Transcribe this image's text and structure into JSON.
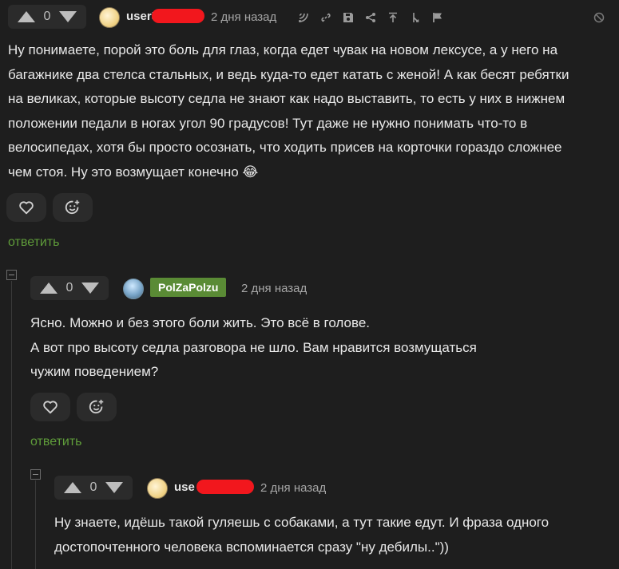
{
  "comments": [
    {
      "rating": "0",
      "username": "user5",
      "time": "2 дня назад",
      "body_lines": [
        "Ну понимаете, порой это боль для глаз, когда едет чувак на новом лексусе, а у него на",
        "багажнике два стелса стальных, и ведь куда-то едет катать с женой! А как бесят ребятки",
        "на великах, которые высоту седла не знают как надо выставить, то есть у них в нижнем",
        "положении педали в ногах угол 90 градусов! Тут даже не нужно понимать что-то в",
        "велосипедах, хотя бы просто осознать, что ходить присев на корточки гораздо сложнее",
        "чем стоя. Ну это возмущает конечно 😂"
      ],
      "reply_label": "ответить"
    },
    {
      "rating": "0",
      "username": "PolZaPolzu",
      "time": "2 дня назад",
      "body_lines": [
        "Ясно. Можно и без этого боли жить. Это всё в голове.",
        "А вот про высоту седла разговора не шло. Вам нравится возмущаться",
        "чужим поведением?"
      ],
      "reply_label": "ответить"
    },
    {
      "rating": "0",
      "username": "use",
      "time": "2 дня назад",
      "body_lines": [
        "Ну знаете, идёшь такой гуляешь с собаками, а тут такие едут. И фраза одного",
        "достопочтенного человека вспоминается сразу \"ну дебилы..\"))"
      ]
    }
  ],
  "icons": {
    "upvote": "arrow-up-icon",
    "downvote": "arrow-down-icon",
    "tools": [
      "branch-icon",
      "link-icon",
      "save-icon",
      "share-icon",
      "go-to-parent-icon",
      "thread-icon",
      "flag-icon"
    ],
    "hide": "hide-icon",
    "like": "heart-icon",
    "emoji": "emoji-add-icon"
  },
  "colors": {
    "background": "#1e1e1e",
    "panel": "#2b2b2b",
    "reply_link": "#5f9c3a",
    "author_badge": "#5a8b35",
    "redaction": "#f2171d"
  }
}
